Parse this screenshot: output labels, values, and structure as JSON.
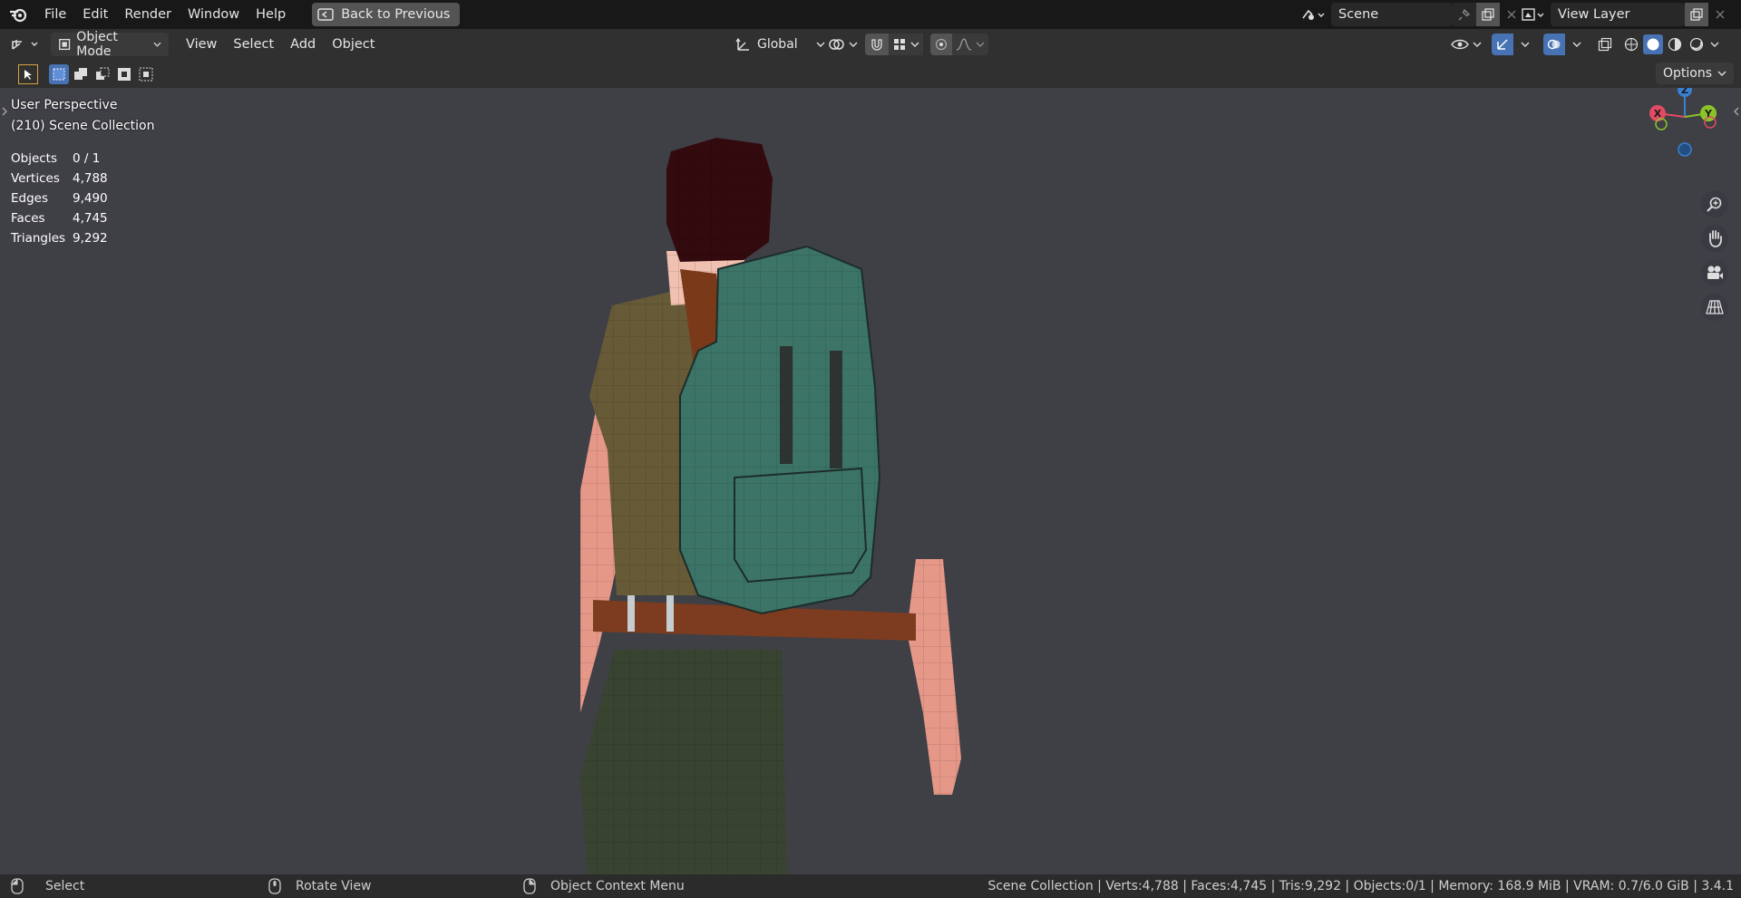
{
  "menubar": {
    "items": [
      "File",
      "Edit",
      "Render",
      "Window",
      "Help"
    ],
    "back_label": "Back to Previous",
    "scene_name": "Scene",
    "view_layer_name": "View Layer"
  },
  "header": {
    "mode": "Object Mode",
    "menus": [
      "View",
      "Select",
      "Add",
      "Object"
    ],
    "orientation": "Global"
  },
  "toolbar": {
    "options_label": "Options"
  },
  "viewport": {
    "view_name": "User Perspective",
    "collection": "(210) Scene Collection",
    "stats": [
      {
        "label": "Objects",
        "value": "0 / 1"
      },
      {
        "label": "Vertices",
        "value": "4,788"
      },
      {
        "label": "Edges",
        "value": "9,490"
      },
      {
        "label": "Faces",
        "value": "4,745"
      },
      {
        "label": "Triangles",
        "value": "9,292"
      }
    ],
    "axes": {
      "x": "X",
      "y": "Y",
      "z": "Z"
    }
  },
  "statusbar": {
    "left_click": "Select",
    "middle_click": "Rotate View",
    "right_click": "Object Context Menu",
    "info": "Scene Collection | Verts:4,788 | Faces:4,745 | Tris:9,292 | Objects:0/1 | Memory: 168.9 MiB | VRAM: 0.7/6.0 GiB | 3.4.1"
  },
  "colors": {
    "viewport_bg": "#3f3f46",
    "accent_blue": "#4772b3",
    "axis_x": "#e24b63",
    "axis_y": "#8ac528",
    "axis_z": "#3b7fd1"
  }
}
